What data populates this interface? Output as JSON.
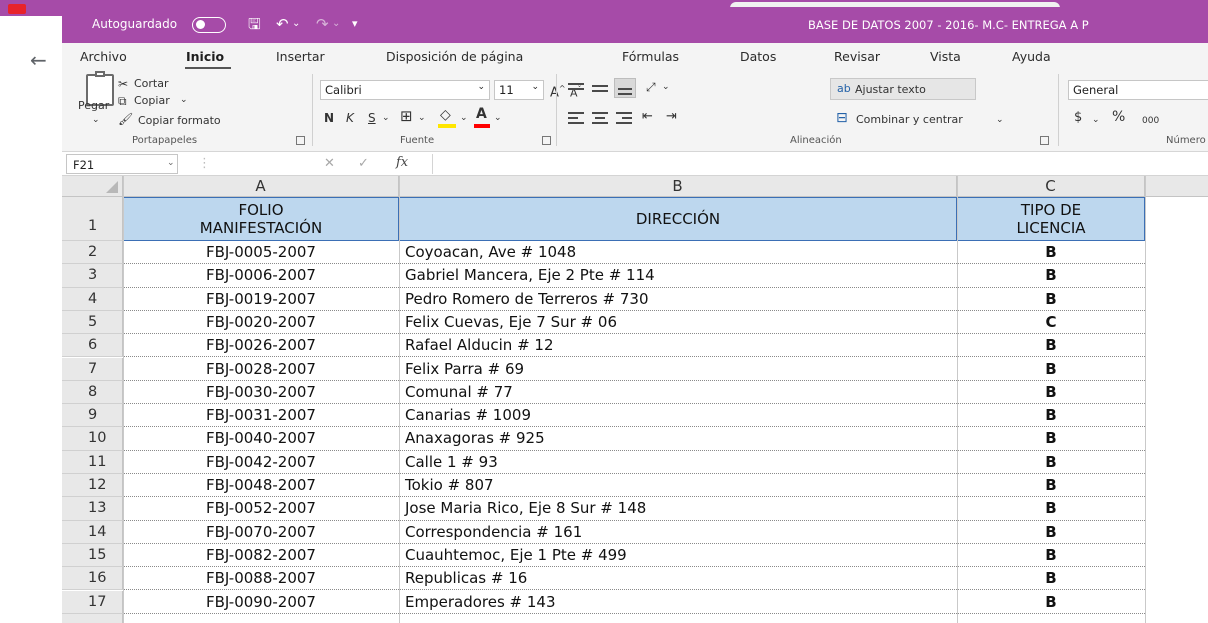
{
  "titlebar": {
    "autosave_label": "Autoguardado",
    "doc_title": "BASE DE DATOS  2007 - 2016- M.C- ENTREGA A P"
  },
  "menu": [
    "Archivo",
    "Inicio",
    "Insertar",
    "Disposición de página",
    "Fórmulas",
    "Datos",
    "Revisar",
    "Vista",
    "Ayuda"
  ],
  "ribbon": {
    "paste_label": "Pegar",
    "cut_label": "Cortar",
    "copy_label": "Copiar",
    "format_painter_label": "Copiar formato",
    "font_name": "Calibri",
    "font_size": "11",
    "bold": "N",
    "italic": "K",
    "underline": "S",
    "wrap_text": "Ajustar texto",
    "merge_center": "Combinar y centrar",
    "number_format": "General",
    "currency": "$",
    "percent": "%",
    "thousands": "000",
    "groups": [
      "Portapapeles",
      "Fuente",
      "Alineación",
      "Número"
    ],
    "accent_color": "#a64ba8"
  },
  "formula_bar": {
    "name_box": "F21",
    "fx": "fx",
    "value": ""
  },
  "sheet": {
    "columns": [
      "A",
      "B",
      "C"
    ],
    "header_row_number": "1",
    "headers": {
      "a": [
        "FOLIO",
        "MANIFESTACIÓN"
      ],
      "b": "DIRECCIÓN",
      "c": [
        "TIPO DE",
        "LICENCIA"
      ]
    },
    "header_fill": "#bdd7ee",
    "rows": [
      {
        "n": "2",
        "folio": "FBJ-0005-2007",
        "dir": "Coyoacan, Ave #  1048",
        "tipo": "B"
      },
      {
        "n": "3",
        "folio": "FBJ-0006-2007",
        "dir": "Gabriel Mancera, Eje 2 Pte #  114",
        "tipo": "B"
      },
      {
        "n": "4",
        "folio": "FBJ-0019-2007",
        "dir": "Pedro Romero de Terreros #  730",
        "tipo": "B"
      },
      {
        "n": "5",
        "folio": "FBJ-0020-2007",
        "dir": "Felix Cuevas, Eje 7 Sur #  06",
        "tipo": "C"
      },
      {
        "n": "6",
        "folio": "FBJ-0026-2007",
        "dir": "Rafael Alducin  #  12",
        "tipo": "B"
      },
      {
        "n": "7",
        "folio": "FBJ-0028-2007",
        "dir": "Felix Parra  #  69",
        "tipo": "B"
      },
      {
        "n": "8",
        "folio": "FBJ-0030-2007",
        "dir": "Comunal  #  77",
        "tipo": "B"
      },
      {
        "n": "9",
        "folio": "FBJ-0031-2007",
        "dir": "Canarias  #  1009",
        "tipo": "B"
      },
      {
        "n": "10",
        "folio": "FBJ-0040-2007",
        "dir": "Anaxagoras #  925",
        "tipo": "B"
      },
      {
        "n": "11",
        "folio": "FBJ-0042-2007",
        "dir": "Calle 1  #  93",
        "tipo": "B"
      },
      {
        "n": "12",
        "folio": "FBJ-0048-2007",
        "dir": "Tokio  #  807",
        "tipo": "B"
      },
      {
        "n": "13",
        "folio": "FBJ-0052-2007",
        "dir": "Jose Maria Rico, Eje 8 Sur #  148",
        "tipo": "B"
      },
      {
        "n": "14",
        "folio": "FBJ-0070-2007",
        "dir": "Correspondencia  #  161",
        "tipo": "B"
      },
      {
        "n": "15",
        "folio": "FBJ-0082-2007",
        "dir": "Cuauhtemoc, Eje 1 Pte #  499",
        "tipo": "B"
      },
      {
        "n": "16",
        "folio": "FBJ-0088-2007",
        "dir": "Republicas  #  16",
        "tipo": "B"
      },
      {
        "n": "17",
        "folio": "FBJ-0090-2007",
        "dir": "Emperadores  #  143",
        "tipo": "B"
      }
    ]
  }
}
